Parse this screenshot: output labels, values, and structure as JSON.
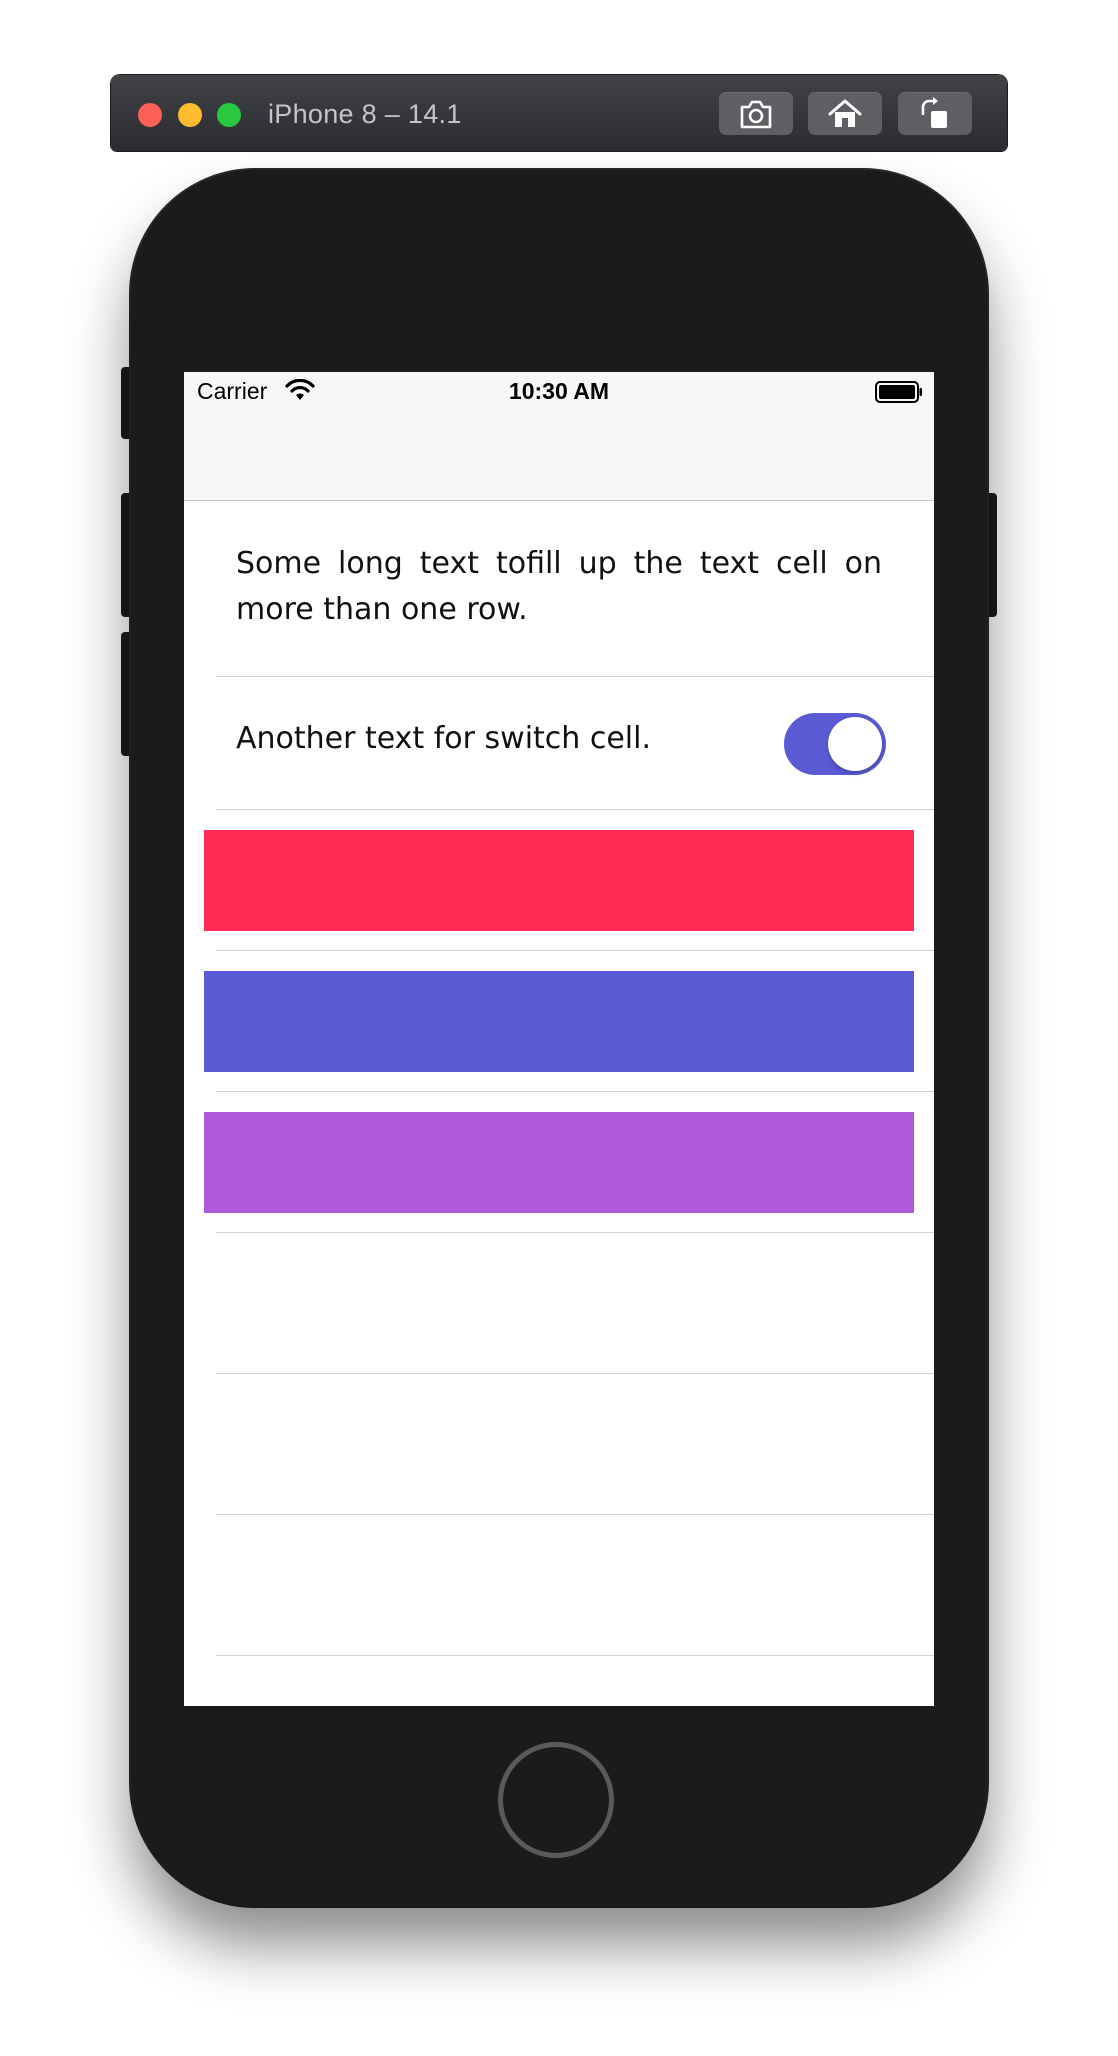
{
  "simulator": {
    "title": "iPhone 8 – 14.1",
    "buttons": [
      {
        "name": "screenshot-icon"
      },
      {
        "name": "home-icon"
      },
      {
        "name": "rotate-icon"
      }
    ]
  },
  "status_bar": {
    "carrier": "Carrier",
    "time": "10:30 AM"
  },
  "table": {
    "text_cell": "Some long text tofill up the text cell on more than one row.",
    "switch_cell": {
      "label": "Another text for switch cell.",
      "on": true
    },
    "color_cells": [
      "#ff2d55",
      "#5a5bd4",
      "#af5add"
    ]
  },
  "colors": {
    "switch_on": "#5a5bd4",
    "phone_body": "#1b1b1b"
  }
}
